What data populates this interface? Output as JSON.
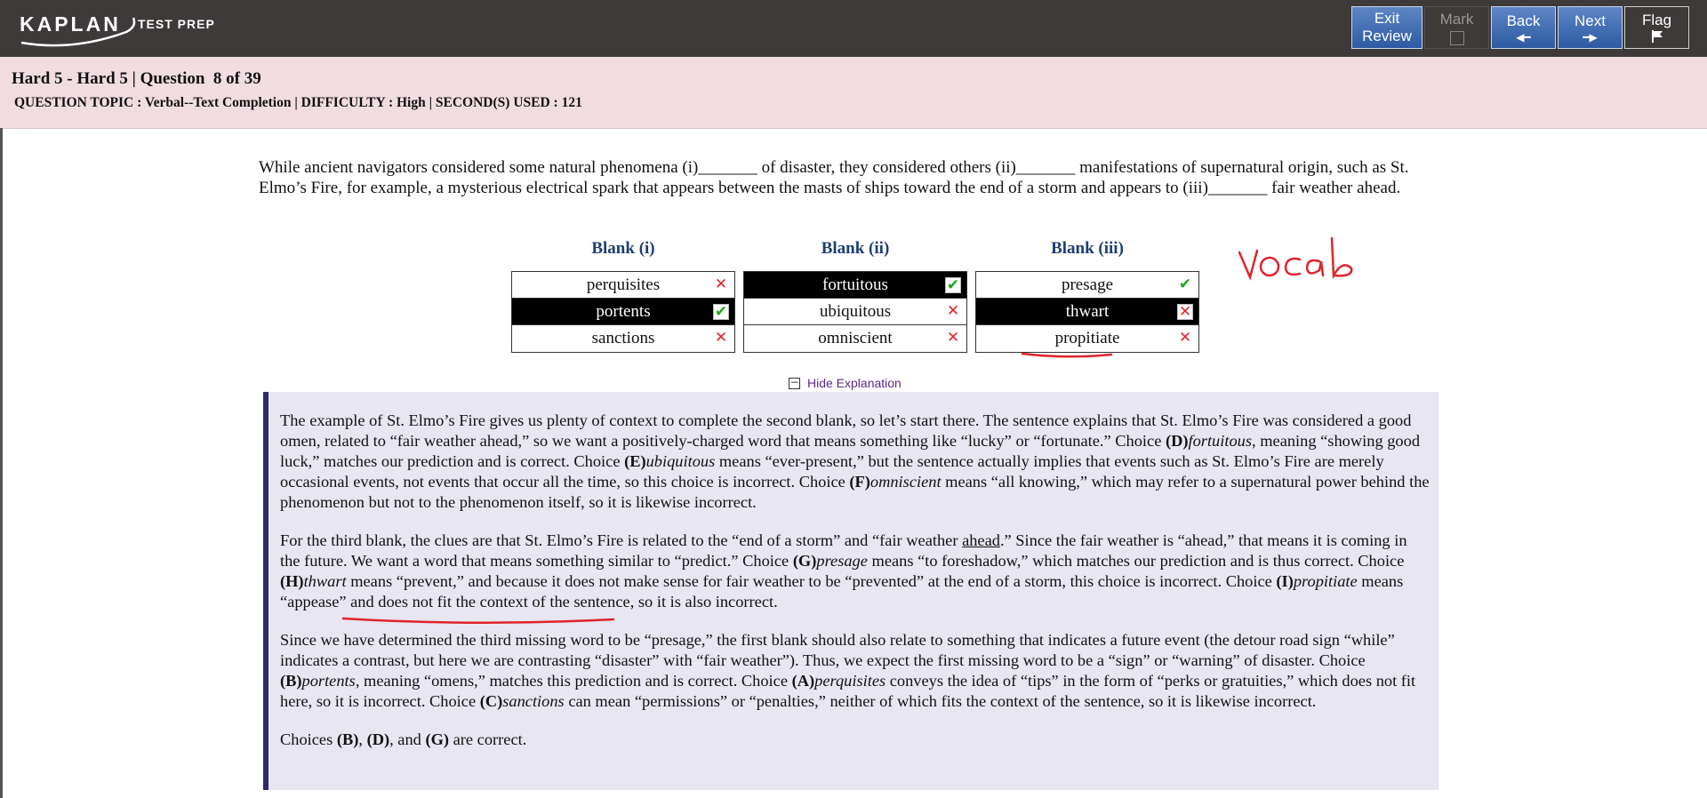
{
  "app": {
    "logo_main": "KAPLAN",
    "logo_sub": "TEST PREP"
  },
  "toolbar": {
    "exit_line1": "Exit",
    "exit_line2": "Review",
    "mark": "Mark",
    "back": "Back",
    "next": "Next",
    "flag": "Flag"
  },
  "header": {
    "title": "Hard 5 - Hard 5 | Question  8 of 39",
    "topic": "QUESTION TOPIC : Verbal--Text Completion | DIFFICULTY : High | SECOND(S) USED : 121"
  },
  "question": {
    "text": "While ancient navigators considered some natural phenomena (i)_______ of disaster, they considered others (ii)_______ manifestations of supernatural origin, such as St. Elmo’s Fire, for example, a mysterious electrical spark that appears between the masts of ships toward the end of a storm and appears to (iii)_______ fair weather ahead."
  },
  "blanks": [
    {
      "header": "Blank (i)",
      "options": [
        {
          "label": "perquisites",
          "selected": false,
          "mark": "x"
        },
        {
          "label": "portents",
          "selected": true,
          "mark": "check"
        },
        {
          "label": "sanctions",
          "selected": false,
          "mark": "x"
        }
      ]
    },
    {
      "header": "Blank (ii)",
      "options": [
        {
          "label": "fortuitous",
          "selected": true,
          "mark": "check"
        },
        {
          "label": "ubiquitous",
          "selected": false,
          "mark": "x"
        },
        {
          "label": "omniscient",
          "selected": false,
          "mark": "x"
        }
      ]
    },
    {
      "header": "Blank (iii)",
      "options": [
        {
          "label": "presage",
          "selected": false,
          "mark": "check"
        },
        {
          "label": "thwart",
          "selected": true,
          "mark": "x"
        },
        {
          "label": "propitiate",
          "selected": false,
          "mark": "x"
        }
      ]
    }
  ],
  "explanation_toggle": "Hide Explanation",
  "explanation": {
    "p1": {
      "a": "The example of St. Elmo’s Fire gives us plenty of context to complete the second blank, so let’s start there. The sentence explains that St. Elmo’s Fire was considered a good omen, related to “fair weather ahead,” so we want a positively-charged word that means something like “lucky” or “fortunate.” Choice ",
      "c1": "(D)",
      "w1": "fortuitous",
      "b": ", meaning “showing good luck,” matches our prediction and is correct. Choice ",
      "c2": "(E)",
      "w2": "ubiquitous",
      "c": " means “ever-present,” but the sentence actually implies that events such as St. Elmo’s Fire are merely occasional events, not events that occur all the time, so this choice is incorrect. Choice ",
      "c3": "(F)",
      "w3": "omniscient",
      "d": " means “all knowing,” which may refer to a supernatural power behind the phenomenon but not to the phenomenon itself, so it is likewise incorrect."
    },
    "p2": {
      "a": "For the third blank, the clues are that St. Elmo’s Fire is related to the “end of a storm” and “fair weather ",
      "u": "ahead",
      "b": ".” Since the fair weather is “ahead,” that means it is coming in the future. We want a word that means something similar to “predict.” Choice ",
      "c1": "(G)",
      "w1": "presage",
      "c": " means “to foreshadow,” which matches our prediction and is thus correct. Choice ",
      "c2": "(H)",
      "w2": "thwart",
      "d": " means “prevent,” and because it does not make sense for fair weather to be “prevented” at the end of a storm, this choice is incorrect. Choice ",
      "c3": "(I)",
      "w3": "propitiate",
      "e": " means “appease” and does not fit the context of the sentence, so it is also incorrect."
    },
    "p3": {
      "a": "Since we have determined the third missing word to be “presage,” the first blank should also relate to something that indicates a future event (the detour road sign “while” indicates a contrast, but here we are contrasting “disaster” with “fair weather”). Thus, we expect the first missing word to be a “sign” or “warning” of disaster. Choice ",
      "c1": "(B)",
      "w1": "portents",
      "b": ", meaning “omens,” matches this prediction and is correct. Choice ",
      "c2": "(A)",
      "w2": "perquisites",
      "c": " conveys the idea of “tips” in the form of “perks or gratuities,” which does not fit here, so it is incorrect. Choice ",
      "c3": "(C)",
      "w3": "sanctions",
      "d": " can mean “permissions” or “penalties,” neither of which fits the context of the sentence, so it is likewise incorrect."
    },
    "p4": {
      "a": "Choices ",
      "c1": "(B)",
      "b": ", ",
      "c2": "(D)",
      "c": ", and ",
      "c3": "(G)",
      "d": " are correct."
    }
  },
  "annotation_handwritten": "vocab",
  "colors": {
    "topbar": "#3d3a39",
    "header_bg": "#f1dde1",
    "button_blue": "#2d5aa3",
    "blank_header": "#1d3f73",
    "explanation_bg": "#e8e6f0",
    "explanation_border": "#2e2a6e",
    "ink_red": "#e0232b"
  }
}
